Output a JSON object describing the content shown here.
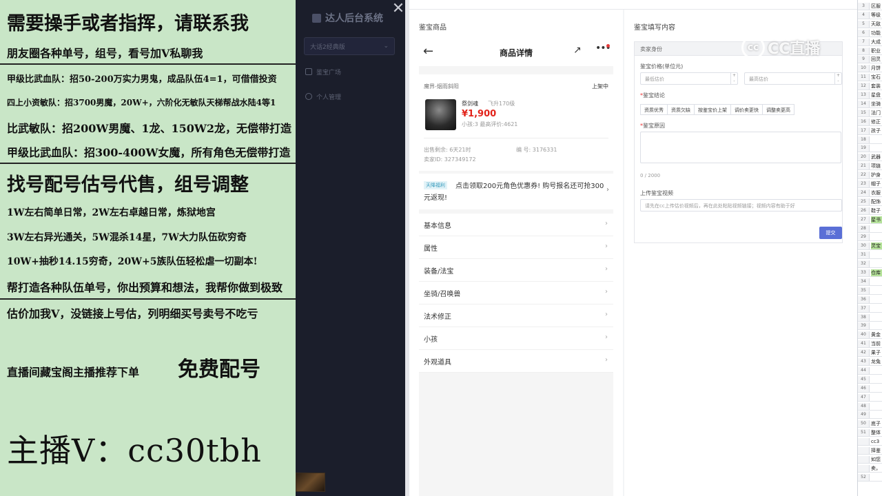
{
  "promo": {
    "lines": [
      "需要操手或者指挥，请联系我",
      "朋友圈各种单号，组号，看号加V私聊我",
      "甲级比武血队：招50-200万实力男鬼，成品队伍4=1，可借借投资",
      "四上小资敏队：招3700男魔，20W+，六阶化无敏队天梯帮战水陆4等1",
      "比武敏队：招200W男魔、1龙、150W2龙，无偿带打造",
      "甲级比武血队：招300-400W女魔，所有角色无偿带打造",
      "找号配号估号代售，组号调整",
      "1W左右简单日常，2W左右卓越日常，炼狱地宫",
      "3W左右异光通关，5W混杀14星，7W大力队伍砍穷奇",
      "10W+抽秒14.15穷奇，20W+5族队伍轻松虐一切副本!",
      "帮打造各种队伍单号，你出预算和想法，我帮你做到极致",
      "估价加我V，没链接上号估，列明细买号卖号不吃亏",
      "直播间藏宝阁主播推荐下单",
      "免费配号",
      "主播V：cc30tbh"
    ]
  },
  "sidebar": {
    "app_title": "达人后台系统",
    "close_glyph": "✕",
    "select_value": "大话2经典版",
    "select_chevron": "⌄",
    "items": [
      {
        "label": "鉴宝广场",
        "icon": "grid-icon"
      },
      {
        "label": "个人管理",
        "icon": "user-icon"
      }
    ]
  },
  "left_panel": {
    "title": "鉴宝商品",
    "phone": {
      "back_glyph": "←",
      "title": "商品详情",
      "share_glyph": "↗",
      "more_glyph": "•••",
      "server": "魔界-烟雨斜阳",
      "status": "上架中",
      "name": "祭剑魂",
      "level": "飞升170级",
      "price": "¥1,900",
      "stats": "小孩:3  最高评价:4621",
      "time_left": "出售剩余: 6天21时",
      "serial": "编 号: 3176331",
      "seller": "卖家ID: 327349172",
      "promo_tag": "天降福利",
      "promo_text": "点击领取200元角色优惠券! 购号报名还可抢300元返现!",
      "chevron": "›",
      "menu": [
        "基本信息",
        "属性",
        "装备/法宝",
        "坐骑/召唤兽",
        "法术修正",
        "小孩",
        "外观道具"
      ]
    }
  },
  "right_panel": {
    "title": "鉴宝填写内容",
    "form_header": "卖家身份",
    "price_label": "鉴宝价格(单位元)",
    "min_placeholder": "最低估价",
    "max_placeholder": "最高估价",
    "spin_up": "+",
    "spin_down": "-",
    "conclusion_label": "鉴宝结论",
    "chips": [
      "资质优秀",
      "资质欠缺",
      "按鉴宝价上架",
      "调价卖更快",
      "调整卖更高"
    ],
    "reason_label": "鉴宝原因",
    "counter": "0 / 2000",
    "video_label": "上传鉴宝视频",
    "video_placeholder": "请先在cc上传估价视频后，再在此处粘贴视频链接；视频内容有助于好",
    "required_mark": "*",
    "submit": "提交"
  },
  "watermark": {
    "logo": "cc",
    "text": "CC直播"
  },
  "sheet": {
    "rows": [
      {
        "n": "3",
        "t": "区服"
      },
      {
        "n": "4",
        "t": "等级"
      },
      {
        "n": "5",
        "t": "天敌"
      },
      {
        "n": "6",
        "t": "功能"
      },
      {
        "n": "7",
        "t": "大成"
      },
      {
        "n": "8",
        "t": "职业"
      },
      {
        "n": "9",
        "t": "回灵"
      },
      {
        "n": "10",
        "t": "月饼"
      },
      {
        "n": "11",
        "t": "宝石"
      },
      {
        "n": "12",
        "t": "套装"
      },
      {
        "n": "13",
        "t": "星盘"
      },
      {
        "n": "14",
        "t": "坐骑"
      },
      {
        "n": "15",
        "t": "法门"
      },
      {
        "n": "16",
        "t": "修正"
      },
      {
        "n": "17",
        "t": "孩子"
      },
      {
        "n": "18",
        "t": ""
      },
      {
        "n": "19",
        "t": ""
      },
      {
        "n": "20",
        "t": "武器"
      },
      {
        "n": "21",
        "t": "项链"
      },
      {
        "n": "22",
        "t": "护身"
      },
      {
        "n": "23",
        "t": "帽子"
      },
      {
        "n": "24",
        "t": "衣服"
      },
      {
        "n": "25",
        "t": "配饰"
      },
      {
        "n": "26",
        "t": "鞋子"
      },
      {
        "n": "27",
        "t": "星书",
        "hl": true
      },
      {
        "n": "28",
        "t": ""
      },
      {
        "n": "29",
        "t": ""
      },
      {
        "n": "30",
        "t": "灵宝",
        "hl": true
      },
      {
        "n": "31",
        "t": ""
      },
      {
        "n": "32",
        "t": ""
      },
      {
        "n": "33",
        "t": "仓库",
        "hl": true
      },
      {
        "n": "34",
        "t": ""
      },
      {
        "n": "35",
        "t": ""
      },
      {
        "n": "36",
        "t": ""
      },
      {
        "n": "37",
        "t": ""
      },
      {
        "n": "38",
        "t": ""
      },
      {
        "n": "39",
        "t": ""
      },
      {
        "n": "40",
        "t": "黄金"
      },
      {
        "n": "41",
        "t": "当前"
      },
      {
        "n": "42",
        "t": "果子"
      },
      {
        "n": "43",
        "t": "龙兔"
      },
      {
        "n": "44",
        "t": ""
      },
      {
        "n": "45",
        "t": ""
      },
      {
        "n": "46",
        "t": ""
      },
      {
        "n": "47",
        "t": ""
      },
      {
        "n": "48",
        "t": ""
      },
      {
        "n": "49",
        "t": ""
      },
      {
        "n": "50",
        "t": "底子"
      },
      {
        "n": "51",
        "t": "整体"
      },
      {
        "n": "",
        "t": "cc3"
      },
      {
        "n": "",
        "t": "择鉴"
      },
      {
        "n": "",
        "t": "如您"
      },
      {
        "n": "",
        "t": "卖，"
      },
      {
        "n": "52",
        "t": ""
      }
    ]
  }
}
